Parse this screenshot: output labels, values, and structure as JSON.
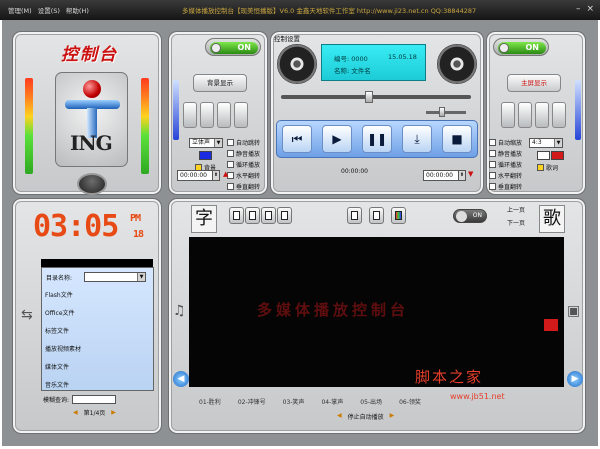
{
  "menu": [
    "管理(M)",
    "设置(S)",
    "帮助(H)"
  ],
  "app_title": "多媒体播放控制台【现美恒播版】V6.0    金鑫天地软件工作室    http://www.ji23.net.cn   QQ:38844287",
  "window_controls": [
    "–",
    "×"
  ],
  "console": {
    "title": "控制台",
    "logo_text": "ING"
  },
  "left_ctrl": {
    "switch_label": "ON",
    "bg_button": "背景显示",
    "channel_select": "立体声",
    "bg_check": "背景",
    "checks": [
      "自动跳转",
      "静音播放",
      "循环播放",
      "水平翻转",
      "垂直翻转"
    ],
    "time": "00:00:00"
  },
  "player": {
    "title": "控制设置",
    "lcd_line1_left": "编号: 0000",
    "lcd_line1_right": "15.05.18",
    "lcd_line2": "名称: 文件名",
    "time_left": "00:00:00",
    "time_center": "00:00:00",
    "time_right": "00:00:00",
    "buttons": [
      "⏮",
      "▶",
      "❚❚",
      "⤓",
      "■"
    ]
  },
  "right_ctrl": {
    "switch_label": "ON",
    "bg_button": "主屏显示",
    "checks": [
      "自动缩放",
      "静音播放",
      "循环播放",
      "水平翻转",
      "垂直翻转"
    ],
    "ratio_select": "4:3",
    "lyrics_check": "歌词",
    "time": "00:00:00"
  },
  "clock": {
    "time": "03:05",
    "ampm": "PM",
    "sec": "18"
  },
  "catalog": {
    "label": "目录名称:",
    "items": [
      "Flash文件",
      "Office文件",
      "标签文件",
      "播放视频素材",
      "媒体文件",
      "音乐文件"
    ],
    "search_label": "模糊查询:",
    "page_text": "第1/4页"
  },
  "stage": {
    "char_left": "字",
    "char_right": "歌",
    "toggle_label": "ON",
    "prev_page": "上一页",
    "next_page": "下一页",
    "ghost_text": "多媒体播放控制台",
    "scenes": [
      "01-胜利",
      "02-冲锋号",
      "03-笑声",
      "04-掌声",
      "05-出场",
      "06-领奖"
    ],
    "stop_button": "停止自动播放"
  },
  "watermark": {
    "main": "脚本之家",
    "sub": "www.jb51.net"
  },
  "colors": {
    "accent_red": "#cc1111",
    "lcd_cyan": "#1ccbd6",
    "transport_blue": "#6ea0e6",
    "clock_orange": "#e74a14"
  }
}
